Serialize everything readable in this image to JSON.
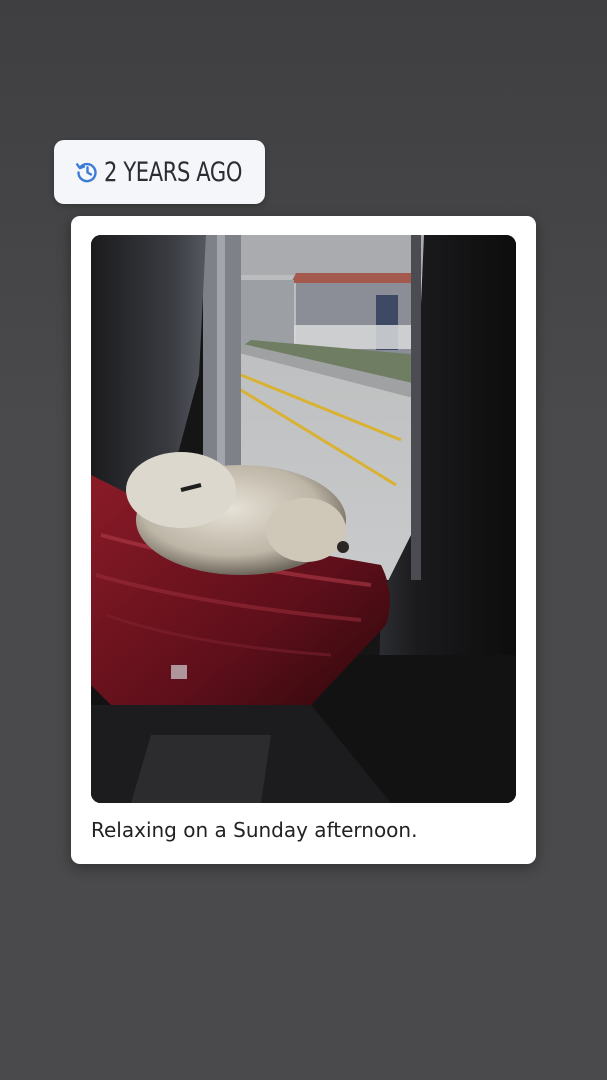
{
  "memory": {
    "icon": "history-icon",
    "label": "2 YEARS AGO",
    "icon_color": "#3a7bd5"
  },
  "post": {
    "photo_icon": "dog-on-windowsill-photo",
    "caption": "Relaxing on a Sunday afternoon."
  },
  "colors": {
    "background": "#4a4a4c",
    "card": "#ffffff",
    "pill": "#f4f6f9"
  }
}
